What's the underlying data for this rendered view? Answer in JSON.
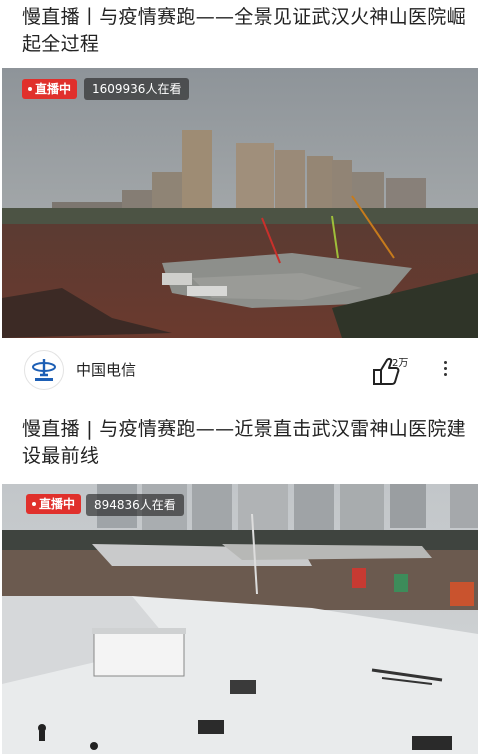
{
  "feed": [
    {
      "title": "慢直播丨与疫情赛跑——全景见证武汉火神山医院崛起全过程",
      "live_label": "直播中",
      "viewers": "1609936人在看"
    },
    {
      "title": "慢直播 | 与疫情赛跑——近景直击武汉雷神山医院建设最前线",
      "live_label": "直播中",
      "viewers": "894836人在看"
    }
  ],
  "channel": {
    "name": "中国电信",
    "avatar_icon": "china-telecom-logo",
    "likes": "2万"
  },
  "colors": {
    "live_red": "#e0302c",
    "telecom_blue": "#1d5fb5"
  }
}
